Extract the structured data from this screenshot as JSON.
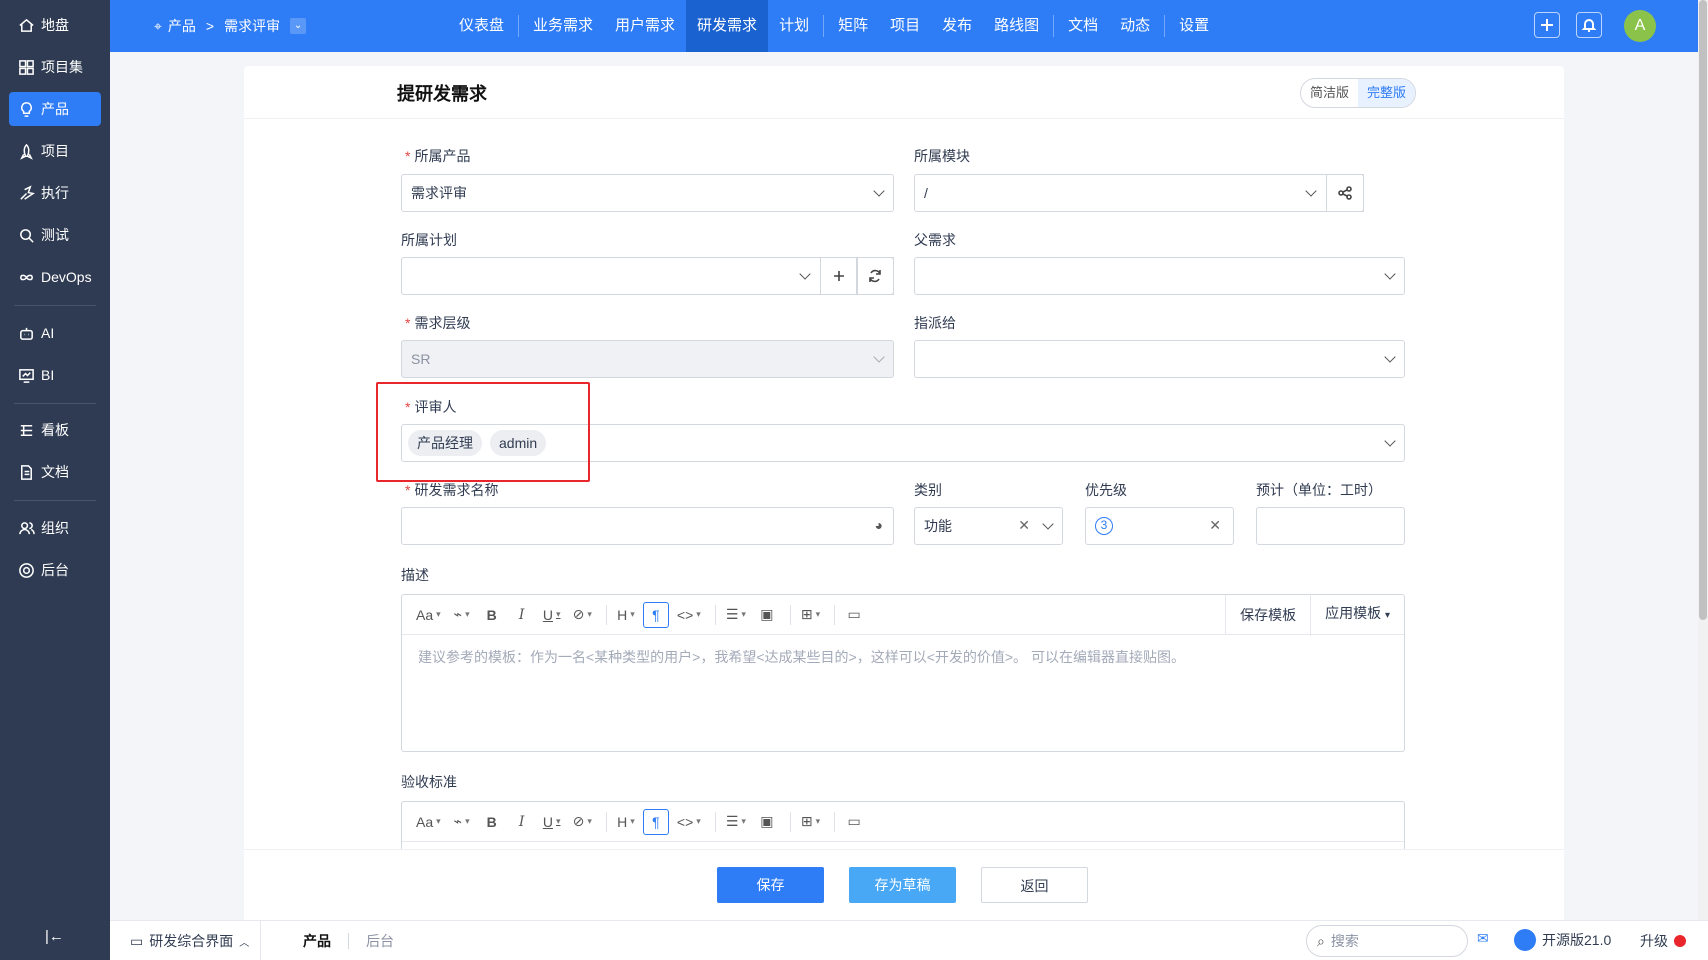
{
  "sidebar": {
    "items": [
      {
        "label": "地盘",
        "icon": "home-icon"
      },
      {
        "label": "项目集",
        "icon": "grid-icon"
      },
      {
        "label": "产品",
        "icon": "lightbulb-icon"
      },
      {
        "label": "项目",
        "icon": "rocket-icon"
      },
      {
        "label": "执行",
        "icon": "run-icon"
      },
      {
        "label": "测试",
        "icon": "search-bug-icon"
      },
      {
        "label": "DevOps",
        "icon": "infinity-icon"
      },
      {
        "label": "AI",
        "icon": "robot-icon"
      },
      {
        "label": "BI",
        "icon": "chart-icon"
      },
      {
        "label": "看板",
        "icon": "kanban-icon"
      },
      {
        "label": "文档",
        "icon": "document-icon"
      },
      {
        "label": "组织",
        "icon": "people-icon"
      },
      {
        "label": "后台",
        "icon": "gear-icon"
      }
    ],
    "collapse": "|←"
  },
  "header": {
    "breadcrumb": {
      "root": "产品",
      "current": "需求评审",
      "separator": ">"
    },
    "nav": [
      "仪表盘",
      "业务需求",
      "用户需求",
      "研发需求",
      "计划",
      "矩阵",
      "项目",
      "发布",
      "路线图",
      "文档",
      "动态",
      "设置"
    ],
    "avatar": "A"
  },
  "form": {
    "title": "提研发需求",
    "modes": [
      "简洁版",
      "完整版"
    ],
    "product": {
      "label": "所属产品",
      "value": "需求评审"
    },
    "module": {
      "label": "所属模块",
      "value": "/"
    },
    "plan": {
      "label": "所属计划",
      "value": ""
    },
    "parent": {
      "label": "父需求",
      "value": ""
    },
    "level": {
      "label": "需求层级",
      "value": "SR"
    },
    "assign": {
      "label": "指派给",
      "value": ""
    },
    "reviewer": {
      "label": "评审人",
      "tags": [
        "产品经理",
        "admin"
      ]
    },
    "name": {
      "label": "研发需求名称",
      "value": ""
    },
    "category": {
      "label": "类别",
      "value": "功能"
    },
    "priority": {
      "label": "优先级",
      "value": "3"
    },
    "estimate": {
      "label": "预计（单位：工时）",
      "value": ""
    },
    "desc": {
      "label": "描述",
      "placeholder": "建议参考的模板：作为一名<某种类型的用户>，我希望<达成某些目的>，这样可以<开发的价值>。 可以在编辑器直接贴图。"
    },
    "accept": {
      "label": "验收标准"
    },
    "toolbar": {
      "save_template": "保存模板",
      "apply_template": "应用模板"
    },
    "buttons": {
      "save": "保存",
      "draft": "存为草稿",
      "back": "返回"
    }
  },
  "footer": {
    "app": "研发综合界面",
    "tabs": [
      "产品",
      "后台"
    ],
    "search_placeholder": "搜索",
    "version": "开源版21.0",
    "upgrade": "升级"
  },
  "colors": {
    "primary": "#2e7cf6",
    "sidebar": "#2f3b52",
    "highlight": "#e9262b"
  }
}
